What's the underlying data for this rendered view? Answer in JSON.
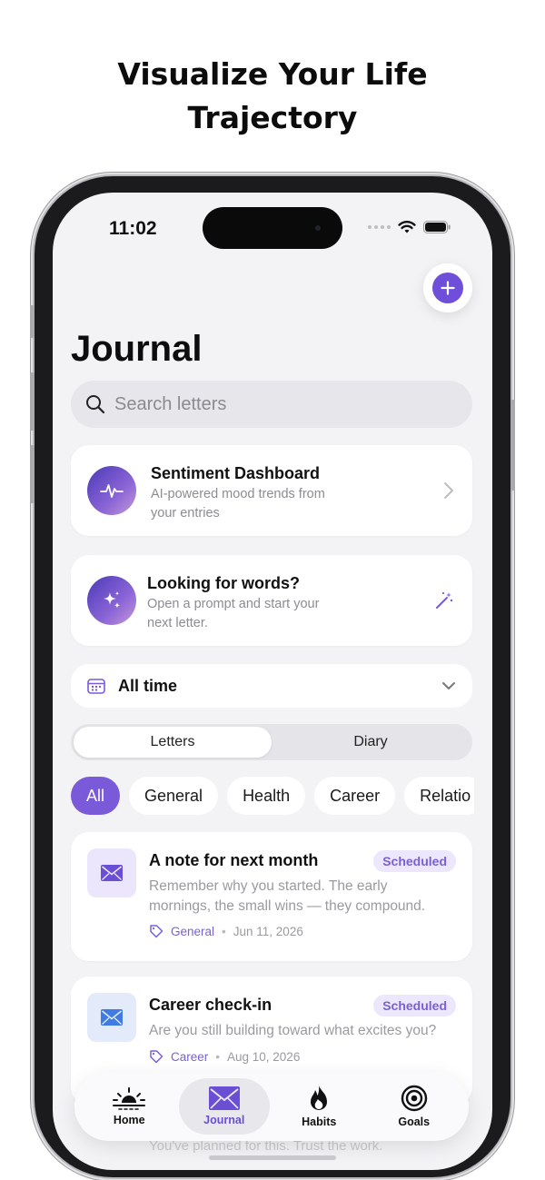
{
  "headline": {
    "line1": "Visualize Your Life",
    "line2": "Trajectory"
  },
  "status_bar": {
    "time": "11:02",
    "icons": [
      "cellular-dots-icon",
      "wifi-icon",
      "battery-icon"
    ]
  },
  "fab": {
    "icon": "plus-icon"
  },
  "page": {
    "title": "Journal"
  },
  "search": {
    "placeholder": "Search letters",
    "icon": "search-icon"
  },
  "sentiment_card": {
    "title": "Sentiment Dashboard",
    "subtitle_line1": "AI-powered mood trends from",
    "subtitle_line2": "your entries",
    "icon": "pulse-icon"
  },
  "prompt_card": {
    "title": "Looking for words?",
    "subtitle_line1": "Open a prompt and start your",
    "subtitle_line2": "next letter.",
    "icon": "sparkles-icon",
    "action_icon": "magic-wand-icon"
  },
  "time_filter": {
    "label": "All time",
    "icon": "calendar-icon"
  },
  "segmented": {
    "items": [
      {
        "label": "Letters",
        "active": true
      },
      {
        "label": "Diary",
        "active": false
      }
    ]
  },
  "chips": {
    "items": [
      {
        "label": "All",
        "active": true
      },
      {
        "label": "General",
        "active": false
      },
      {
        "label": "Health",
        "active": false
      },
      {
        "label": "Career",
        "active": false
      },
      {
        "label": "Relatio",
        "active": false
      }
    ]
  },
  "letters": [
    {
      "title": "A note for next month",
      "badge": "Scheduled",
      "body_line1": "Remember why you started. The early",
      "body_line2": "mornings, the small wins — they compound.",
      "category": "General",
      "separator": "•",
      "date": "Jun 11, 2026"
    },
    {
      "title": "Career check-in",
      "badge": "Scheduled",
      "body_line1": "Are you still building toward what excites you?",
      "category": "Career",
      "separator": "•",
      "date": "Aug 10, 2026"
    }
  ],
  "partial_text": "You've planned for this. Trust the work.",
  "tabbar": {
    "items": [
      {
        "label": "Home",
        "icon": "sunrise-icon",
        "active": false
      },
      {
        "label": "Journal",
        "icon": "envelope-icon",
        "active": true
      },
      {
        "label": "Habits",
        "icon": "flame-icon",
        "active": false
      },
      {
        "label": "Goals",
        "icon": "target-icon",
        "active": false
      }
    ]
  },
  "colors": {
    "accent": "#7a5ad9",
    "screen_bg": "#f3f3f6",
    "card_bg": "#ffffff",
    "badge_bg": "#ece7fc"
  }
}
